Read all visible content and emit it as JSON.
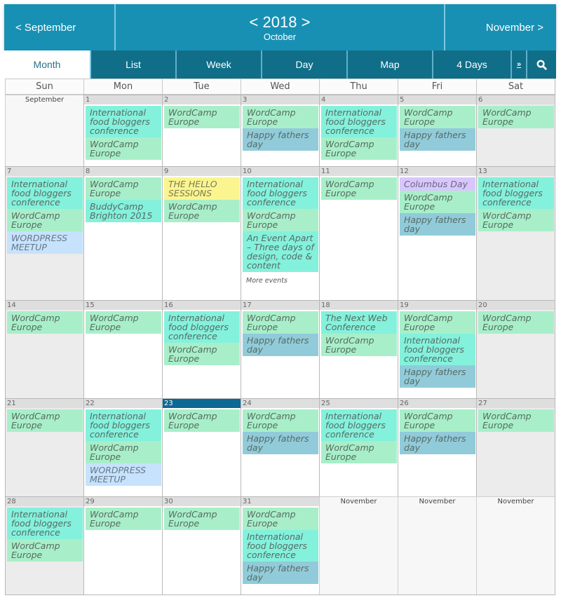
{
  "header": {
    "prev_month": "< September",
    "year_prev": "<",
    "year": "2018",
    "year_next": ">",
    "current_month": "October",
    "next_month": "November >"
  },
  "tabs": [
    {
      "label": "Month",
      "active": true
    },
    {
      "label": "List",
      "active": false
    },
    {
      "label": "Week",
      "active": false
    },
    {
      "label": "Day",
      "active": false
    },
    {
      "label": "Map",
      "active": false
    },
    {
      "label": "4 Days",
      "active": false
    }
  ],
  "more_tab": {
    "label": "»",
    "icon": "double-chevron-right-icon"
  },
  "search": {
    "icon": "search-icon"
  },
  "weekdays": [
    "Sun",
    "Mon",
    "Tue",
    "Wed",
    "Thu",
    "Fri",
    "Sat"
  ],
  "colors": {
    "header_bg": "#1890b4",
    "tabs_bg": "#116e88",
    "today": "#0c6993",
    "wordcamp": "#a8efc9",
    "food": "#84f1dc",
    "fathers": "#91cbda",
    "meetup": "#c6e2fc",
    "hello": "#fbf590",
    "columbus": "#d8c7fa"
  },
  "weeks": [
    {
      "days": [
        {
          "other_month": "September"
        },
        {
          "day": "1",
          "events": [
            {
              "title": "International food bloggers conference",
              "type": "food"
            },
            {
              "title": "WordCamp Europe",
              "type": "wordcamp"
            }
          ]
        },
        {
          "day": "2",
          "events": [
            {
              "title": "WordCamp Europe",
              "type": "wordcamp"
            }
          ]
        },
        {
          "day": "3",
          "events": [
            {
              "title": "WordCamp Europe",
              "type": "wordcamp"
            },
            {
              "title": "Happy fathers day",
              "type": "fathers"
            }
          ]
        },
        {
          "day": "4",
          "events": [
            {
              "title": "International food bloggers conference",
              "type": "food"
            },
            {
              "title": "WordCamp Europe",
              "type": "wordcamp"
            }
          ]
        },
        {
          "day": "5",
          "events": [
            {
              "title": "WordCamp Europe",
              "type": "wordcamp"
            },
            {
              "title": "Happy fathers day",
              "type": "fathers"
            }
          ]
        },
        {
          "day": "6",
          "events": [
            {
              "title": "WordCamp Europe",
              "type": "wordcamp"
            }
          ]
        }
      ]
    },
    {
      "days": [
        {
          "day": "7",
          "events": [
            {
              "title": "International food bloggers conference",
              "type": "food"
            },
            {
              "title": "WordCamp Europe",
              "type": "wordcamp"
            },
            {
              "title": "WORDPRESS MEETUP",
              "type": "meetup"
            }
          ]
        },
        {
          "day": "8",
          "events": [
            {
              "title": "WordCamp Europe",
              "type": "wordcamp"
            },
            {
              "title": "BuddyCamp Brighton 2015",
              "type": "buddy"
            }
          ]
        },
        {
          "day": "9",
          "events": [
            {
              "title": "THE HELLO SESSIONS",
              "type": "hello"
            },
            {
              "title": "WordCamp Europe",
              "type": "wordcamp"
            }
          ]
        },
        {
          "day": "10",
          "events": [
            {
              "title": "International food bloggers conference",
              "type": "food"
            },
            {
              "title": "WordCamp Europe",
              "type": "wordcamp"
            },
            {
              "title": "An Event Apart – Three days of design, code & content",
              "type": "apart"
            }
          ],
          "more": "More events"
        },
        {
          "day": "11",
          "events": [
            {
              "title": "WordCamp Europe",
              "type": "wordcamp"
            }
          ]
        },
        {
          "day": "12",
          "events": [
            {
              "title": "Columbus Day",
              "type": "columbus"
            },
            {
              "title": "WordCamp Europe",
              "type": "wordcamp"
            },
            {
              "title": "Happy fathers day",
              "type": "fathers"
            }
          ]
        },
        {
          "day": "13",
          "events": [
            {
              "title": "International food bloggers conference",
              "type": "food"
            },
            {
              "title": "WordCamp Europe",
              "type": "wordcamp"
            }
          ]
        }
      ]
    },
    {
      "days": [
        {
          "day": "14",
          "events": [
            {
              "title": "WordCamp Europe",
              "type": "wordcamp"
            }
          ]
        },
        {
          "day": "15",
          "events": [
            {
              "title": "WordCamp Europe",
              "type": "wordcamp"
            }
          ]
        },
        {
          "day": "16",
          "events": [
            {
              "title": "International food bloggers conference",
              "type": "food"
            },
            {
              "title": "WordCamp Europe",
              "type": "wordcamp"
            }
          ]
        },
        {
          "day": "17",
          "events": [
            {
              "title": "WordCamp Europe",
              "type": "wordcamp"
            },
            {
              "title": "Happy fathers day",
              "type": "fathers"
            }
          ]
        },
        {
          "day": "18",
          "events": [
            {
              "title": "The Next Web Conference",
              "type": "nextweb"
            },
            {
              "title": "WordCamp Europe",
              "type": "wordcamp"
            }
          ]
        },
        {
          "day": "19",
          "events": [
            {
              "title": "WordCamp Europe",
              "type": "wordcamp"
            },
            {
              "title": "International food bloggers conference",
              "type": "food"
            },
            {
              "title": "Happy fathers day",
              "type": "fathers"
            }
          ]
        },
        {
          "day": "20",
          "events": [
            {
              "title": "WordCamp Europe",
              "type": "wordcamp"
            }
          ]
        }
      ]
    },
    {
      "days": [
        {
          "day": "21",
          "events": [
            {
              "title": "WordCamp Europe",
              "type": "wordcamp"
            }
          ]
        },
        {
          "day": "22",
          "events": [
            {
              "title": "International food bloggers conference",
              "type": "food"
            },
            {
              "title": "WordCamp Europe",
              "type": "wordcamp"
            },
            {
              "title": "WORDPRESS MEETUP",
              "type": "meetup"
            }
          ]
        },
        {
          "day": "23",
          "today": true,
          "events": [
            {
              "title": "WordCamp Europe",
              "type": "wordcamp"
            }
          ]
        },
        {
          "day": "24",
          "events": [
            {
              "title": "WordCamp Europe",
              "type": "wordcamp"
            },
            {
              "title": "Happy fathers day",
              "type": "fathers"
            }
          ]
        },
        {
          "day": "25",
          "events": [
            {
              "title": "International food bloggers conference",
              "type": "food"
            },
            {
              "title": "WordCamp Europe",
              "type": "wordcamp"
            }
          ]
        },
        {
          "day": "26",
          "events": [
            {
              "title": "WordCamp Europe",
              "type": "wordcamp"
            },
            {
              "title": "Happy fathers day",
              "type": "fathers"
            }
          ]
        },
        {
          "day": "27",
          "events": [
            {
              "title": "WordCamp Europe",
              "type": "wordcamp"
            }
          ]
        }
      ]
    },
    {
      "days": [
        {
          "day": "28",
          "events": [
            {
              "title": "International food bloggers conference",
              "type": "food"
            },
            {
              "title": "WordCamp Europe",
              "type": "wordcamp"
            }
          ]
        },
        {
          "day": "29",
          "events": [
            {
              "title": "WordCamp Europe",
              "type": "wordcamp"
            }
          ]
        },
        {
          "day": "30",
          "events": [
            {
              "title": "WordCamp Europe",
              "type": "wordcamp"
            }
          ]
        },
        {
          "day": "31",
          "events": [
            {
              "title": "WordCamp Europe",
              "type": "wordcamp"
            },
            {
              "title": "International food bloggers conference",
              "type": "food"
            },
            {
              "title": "Happy fathers day",
              "type": "fathers"
            }
          ]
        },
        {
          "other_month": "November"
        },
        {
          "other_month": "November"
        },
        {
          "other_month": "November"
        }
      ]
    }
  ]
}
